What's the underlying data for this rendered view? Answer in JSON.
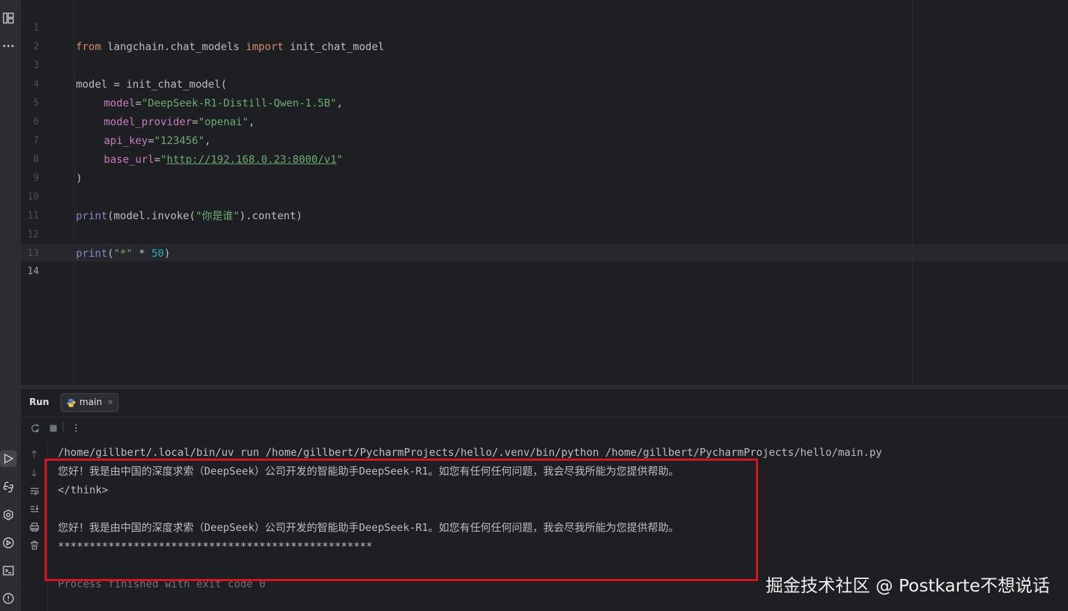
{
  "editor": {
    "lines": [
      {
        "n": "1"
      },
      {
        "n": "2"
      },
      {
        "n": "3"
      },
      {
        "n": "4"
      },
      {
        "n": "5"
      },
      {
        "n": "6"
      },
      {
        "n": "7"
      },
      {
        "n": "8"
      },
      {
        "n": "9"
      },
      {
        "n": "10"
      },
      {
        "n": "11"
      },
      {
        "n": "12"
      },
      {
        "n": "13"
      },
      {
        "n": "14"
      }
    ],
    "tokens": {
      "l1_from": "from",
      "l1_mod": " langchain.chat_models ",
      "l1_import": "import",
      "l1_name": " init_chat_model",
      "l3": "model = init_chat_model(",
      "l4_param": "model",
      "l4_eq": "=",
      "l4_str": "\"DeepSeek-R1-Distill-Qwen-1.5B\"",
      "l4_end": ",",
      "l5_param": "model_provider",
      "l5_eq": "=",
      "l5_str": "\"openai\"",
      "l5_end": ",",
      "l6_param": "api_key",
      "l6_eq": "=",
      "l6_str": "\"123456\"",
      "l6_end": ",",
      "l7_param": "base_url",
      "l7_eq": "=",
      "l7_q1": "\"",
      "l7_url": "http://192.168.0.23:8000/v1",
      "l7_q2": "\"",
      "l8": ")",
      "l10_fn": "print",
      "l10_a": "(model.invoke(",
      "l10_str": "\"你是谁\"",
      "l10_b": ").content)",
      "l12_fn": "print",
      "l12_a": "(",
      "l12_str": "\"*\"",
      "l12_op": " * ",
      "l12_num": "50",
      "l12_b": ")"
    }
  },
  "run_panel": {
    "title": "Run",
    "tab_label": "main",
    "tab_close": "×",
    "output": [
      "/home/gillbert/.local/bin/uv run /home/gillbert/PycharmProjects/hello/.venv/bin/python /home/gillbert/PycharmProjects/hello/main.py",
      "您好！我是由中国的深度求索（DeepSeek）公司开发的智能助手DeepSeek-R1。如您有任何任何问题，我会尽我所能为您提供帮助。",
      "</think>",
      "",
      "您好！我是由中国的深度求索（DeepSeek）公司开发的智能助手DeepSeek-R1。如您有任何任何问题，我会尽我所能为您提供帮助。",
      "**************************************************",
      "",
      "Process finished with exit code 0"
    ]
  },
  "watermark": "掘金技术社区 @ Postkarte不想说话",
  "colors": {
    "highlight_box": "#e0141e",
    "keyword": "#cf8e6d",
    "string": "#6aab73",
    "param": "#c77dbb",
    "number": "#2aacb8"
  }
}
